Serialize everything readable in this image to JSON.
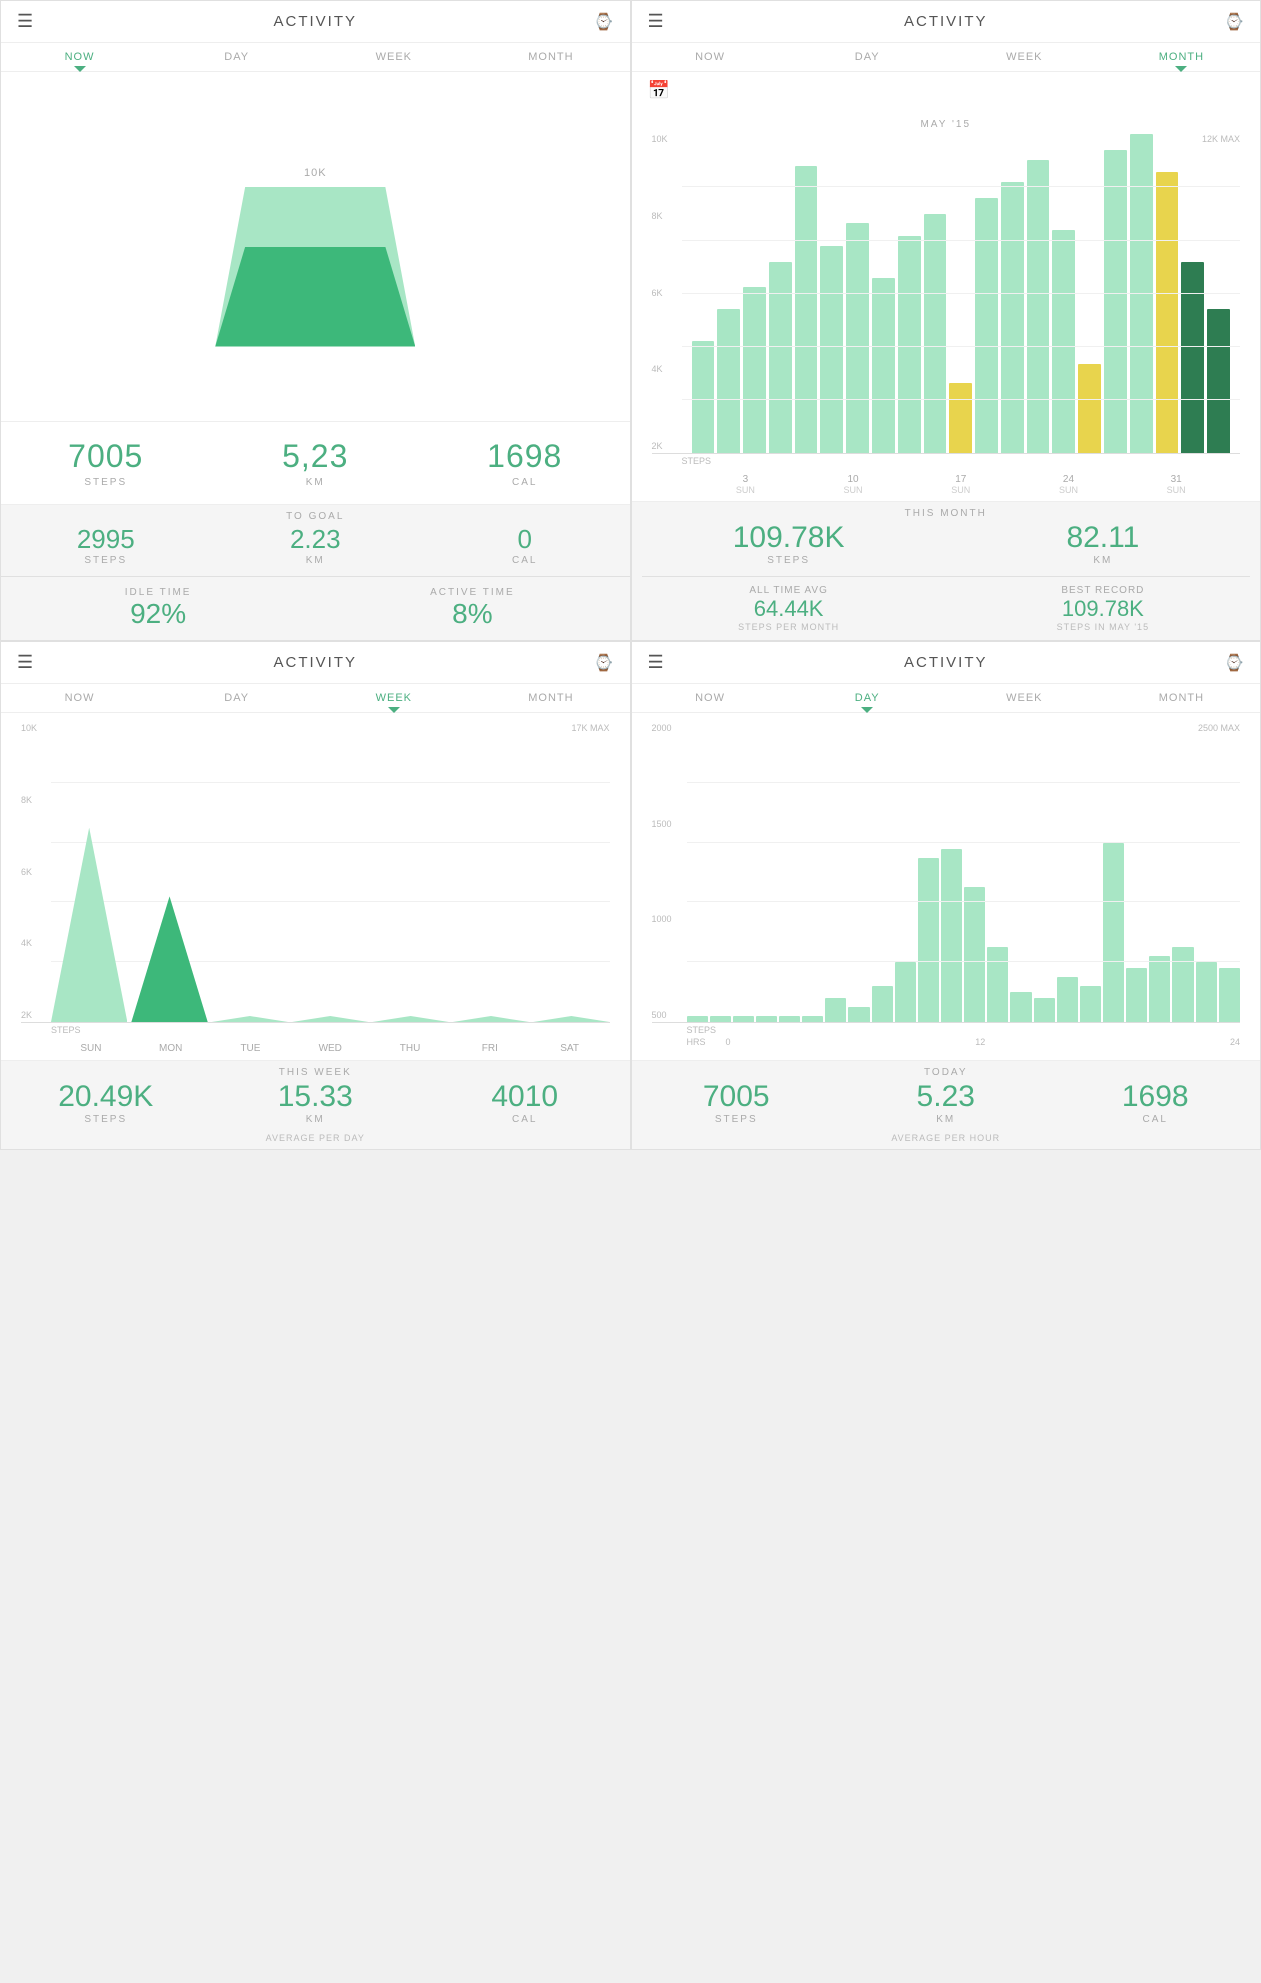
{
  "panels": {
    "now": {
      "title": "ACTIVITY",
      "tabs": [
        "NOW",
        "DAY",
        "WEEK",
        "MONTH"
      ],
      "active_tab": "NOW",
      "trapezoid_label": "10K",
      "stats": [
        {
          "value": "7005",
          "label": "STEPS"
        },
        {
          "value": "5,23",
          "label": "KM"
        },
        {
          "value": "1698",
          "label": "CAL"
        }
      ],
      "goal_header": "TO GOAL",
      "goal_stats": [
        {
          "value": "2995",
          "label": "STEPS"
        },
        {
          "value": "2.23",
          "label": "KM"
        },
        {
          "value": "0",
          "label": "CAL"
        }
      ],
      "idle_time_label": "IDLE TIME",
      "idle_time_value": "92%",
      "active_time_label": "ACTIVE TIME",
      "active_time_value": "8%"
    },
    "month": {
      "title": "ACTIVITY",
      "tabs": [
        "NOW",
        "DAY",
        "WEEK",
        "MONTH"
      ],
      "active_tab": "MONTH",
      "month_label": "MAY '15",
      "max_label": "12K MAX",
      "y_labels": [
        "2K",
        "4K",
        "6K",
        "8K",
        "10K"
      ],
      "x_labels": [
        {
          "num": "3",
          "day": "SUN"
        },
        {
          "num": "10",
          "day": "SUN"
        },
        {
          "num": "17",
          "day": "SUN"
        },
        {
          "num": "24",
          "day": "SUN"
        },
        {
          "num": "31",
          "day": "SUN"
        }
      ],
      "steps_label": "STEPS",
      "stats_header": "THIS MONTH",
      "stats": [
        {
          "value": "109.78K",
          "label": "STEPS"
        },
        {
          "value": "82.11",
          "label": "KM"
        }
      ],
      "alltime_label": "ALL TIME AVG",
      "alltime_value": "64.44K",
      "alltime_sublabel": "STEPS PER MONTH",
      "best_label": "BEST RECORD",
      "best_value": "109.78K",
      "best_sublabel": "STEPS IN MAY '15"
    },
    "week": {
      "title": "ACTIVITY",
      "tabs": [
        "NOW",
        "DAY",
        "WEEK",
        "MONTH"
      ],
      "active_tab": "WEEK",
      "max_label": "17K MAX",
      "y_labels": [
        "2K",
        "4K",
        "6K",
        "8K",
        "10K"
      ],
      "x_labels": [
        "SUN",
        "MON",
        "TUE",
        "WED",
        "THU",
        "FRI",
        "SAT"
      ],
      "steps_label": "STEPS",
      "stats_header": "THIS WEEK",
      "stats": [
        {
          "value": "20.49K",
          "label": "STEPS"
        },
        {
          "value": "15.33",
          "label": "KM"
        },
        {
          "value": "4010",
          "label": "CAL"
        }
      ],
      "avg_label": "AVERAGE PER DAY"
    },
    "day": {
      "title": "ACTIVITY",
      "tabs": [
        "NOW",
        "DAY",
        "WEEK",
        "MONTH"
      ],
      "active_tab": "DAY",
      "max_label": "2500 MAX",
      "y_labels": [
        "500",
        "1000",
        "1500",
        "2000"
      ],
      "hrs_label": "HRS",
      "x_labels": [
        "0",
        "12",
        "24"
      ],
      "steps_label": "STEPS",
      "stats_header": "TODAY",
      "stats": [
        {
          "value": "7005",
          "label": "STEPS"
        },
        {
          "value": "5.23",
          "label": "KM"
        },
        {
          "value": "1698",
          "label": "CAL"
        }
      ],
      "avg_label": "AVERAGE PER HOUR"
    }
  }
}
